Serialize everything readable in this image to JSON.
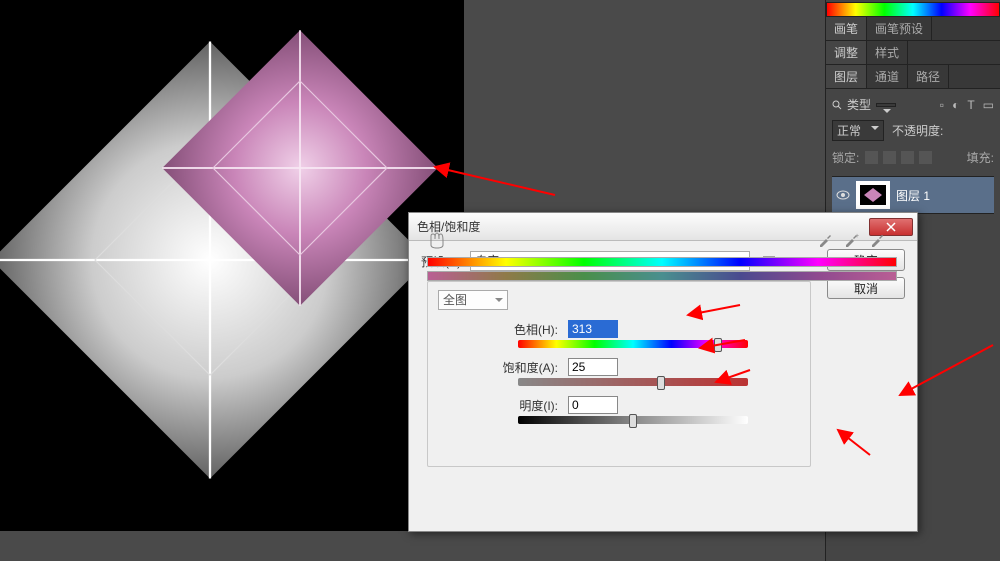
{
  "right_panel": {
    "tabs_row1": [
      "画笔",
      "画笔预设"
    ],
    "tabs_row2": [
      "调整",
      "样式"
    ],
    "tabs_row3": [
      "图层",
      "通道",
      "路径"
    ],
    "type_filter_label": "类型",
    "blend_mode": "正常",
    "opacity_label": "不透明度:",
    "lock_label": "锁定:",
    "fill_label": "填充:",
    "layer_name": "图层 1"
  },
  "dialog": {
    "title": "色相/饱和度",
    "preset_label": "预设(E):",
    "preset_value": "自定",
    "ok_label": "确定",
    "cancel_label": "取消",
    "master_label": "全图",
    "hue_label": "色相(H):",
    "hue_value": "313",
    "sat_label": "饱和度(A):",
    "sat_value": "25",
    "light_label": "明度(I):",
    "light_value": "0"
  }
}
